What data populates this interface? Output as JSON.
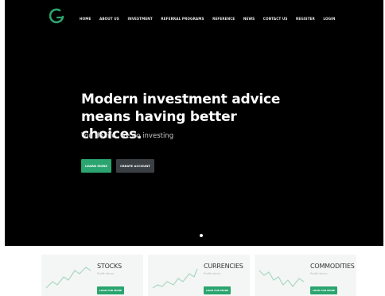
{
  "nav": {
    "items": [
      {
        "label": "HOME"
      },
      {
        "label": "ABOUT US"
      },
      {
        "label": "INVESTMENT"
      },
      {
        "label": "REFERRAL PROGRAMS"
      },
      {
        "label": "REFERENCE"
      },
      {
        "label": "NEWS"
      },
      {
        "label": "CONTACT US"
      },
      {
        "label": "REGISTER"
      },
      {
        "label": "LOGIN"
      }
    ]
  },
  "hero": {
    "headline_line1": "Modern investment advice",
    "headline_line2": "means having better choices.",
    "tagline": "You do life, we do investing",
    "learn_button": "LEARN MORE",
    "create_button": "CREATE ACCOUNT"
  },
  "cards": [
    {
      "title": "STOCKS",
      "subtitle": "Profit return",
      "button": "LOOK FOR MORE"
    },
    {
      "title": "CURRENCIES",
      "subtitle": "Profit return",
      "button": "LOOK FOR MORE"
    },
    {
      "title": "COMMODITIES",
      "subtitle": "Profit return",
      "button": "LOOK FOR MORE"
    }
  ],
  "colors": {
    "accent": "#2aa56f",
    "hero_bg": "#000000",
    "secondary_button": "#3a3f44"
  },
  "icons": {
    "logo": "brand-logo-icon",
    "chart": "trend-line-icon"
  }
}
